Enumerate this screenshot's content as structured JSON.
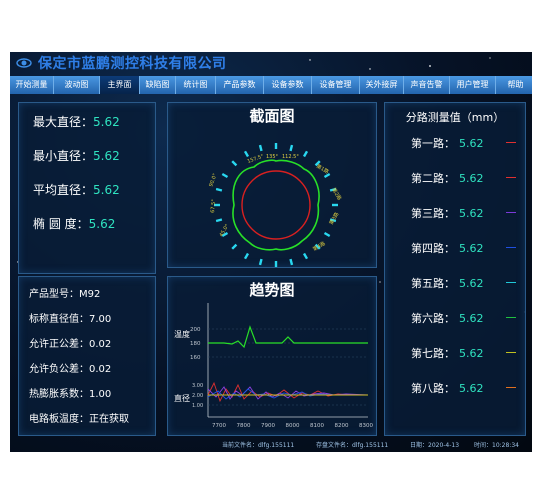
{
  "header": {
    "company": "保定市蓝鹏测控科技有限公司"
  },
  "menu": [
    {
      "label": "开始测量",
      "active": false
    },
    {
      "label": "波动图",
      "active": false
    },
    {
      "label": "主界面",
      "active": true
    },
    {
      "label": "缺陷图",
      "active": false
    },
    {
      "label": "统计图",
      "active": false
    },
    {
      "label": "产品参数",
      "active": false
    },
    {
      "label": "设备参数",
      "active": false
    },
    {
      "label": "设备管理",
      "active": false
    },
    {
      "label": "关外接屏",
      "active": false
    },
    {
      "label": "声音告警",
      "active": false
    },
    {
      "label": "用户管理",
      "active": false
    },
    {
      "label": "帮助",
      "active": false
    }
  ],
  "diameters": [
    {
      "label": "最大直径：",
      "value": "5.62"
    },
    {
      "label": "最小直径：",
      "value": "5.62"
    },
    {
      "label": "平均直径：",
      "value": "5.62"
    },
    {
      "label": "椭 圆 度：",
      "value": "5.62"
    }
  ],
  "product_info": [
    {
      "label": "产品型号：",
      "value": "M92"
    },
    {
      "label": "标称直径值：",
      "value": "7.00"
    },
    {
      "label": "允许正公差：",
      "value": "0.02"
    },
    {
      "label": "允许负公差：",
      "value": "0.02"
    },
    {
      "label": "热膨胀系数：",
      "value": "1.00"
    },
    {
      "label": "电路板温度：",
      "value": "正在获取"
    }
  ],
  "section": {
    "title": "截面图",
    "top_labels": [
      "157.5°",
      "135°",
      "112.5°"
    ],
    "left_labels": [
      "90.0°",
      "67.5°",
      "45.0°"
    ],
    "route_labels": [
      "第1路",
      "第2路",
      "第3路",
      "第4路"
    ]
  },
  "trend": {
    "title": "趋势图",
    "temp_label": "温度",
    "diam_label": "直径",
    "temp_ticks": [
      "200",
      "180",
      "160"
    ],
    "diam_ticks": [
      "3.00",
      "2.00",
      "1.00"
    ],
    "x_ticks": [
      "7700",
      "7800",
      "7900",
      "8000",
      "8100",
      "8200",
      "8300"
    ]
  },
  "routes": {
    "title": "分路测量值（mm）",
    "items": [
      {
        "label": "第一路：",
        "value": "5.62",
        "color": "#e03030"
      },
      {
        "label": "第二路：",
        "value": "5.62",
        "color": "#e03030"
      },
      {
        "label": "第三路：",
        "value": "5.62",
        "color": "#7a3ad8"
      },
      {
        "label": "第四路：",
        "value": "5.62",
        "color": "#2050e0"
      },
      {
        "label": "第五路：",
        "value": "5.62",
        "color": "#20c8d8"
      },
      {
        "label": "第六路：",
        "value": "5.62",
        "color": "#20c040"
      },
      {
        "label": "第七路：",
        "value": "5.62",
        "color": "#c0c020"
      },
      {
        "label": "第八路：",
        "value": "5.62",
        "color": "#e07020"
      }
    ]
  },
  "status": {
    "current_file": "当前文件名：dlfg.155111",
    "saved_file": "存盘文件名：dlfg.155111",
    "date": "日期：2020-4-13",
    "time": "时间：10:28:34"
  },
  "colors": {
    "accent": "#2fe3c0",
    "brand": "#2f7fe8",
    "ring_green": "#28e028",
    "ring_red": "#d82020",
    "tick_cyan": "#29d8f0"
  }
}
